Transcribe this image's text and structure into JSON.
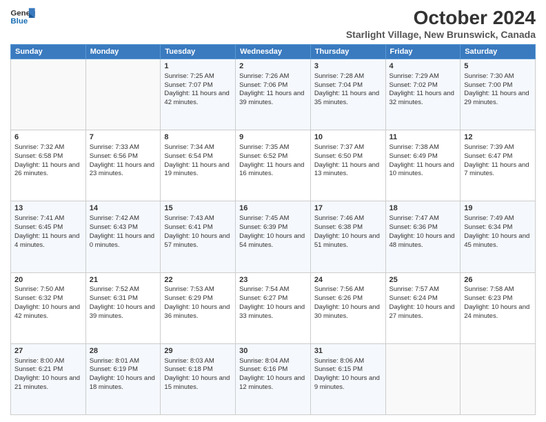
{
  "logo": {
    "line1": "General",
    "line2": "Blue"
  },
  "title": "October 2024",
  "subtitle": "Starlight Village, New Brunswick, Canada",
  "days_of_week": [
    "Sunday",
    "Monday",
    "Tuesday",
    "Wednesday",
    "Thursday",
    "Friday",
    "Saturday"
  ],
  "weeks": [
    [
      {
        "day": "",
        "content": ""
      },
      {
        "day": "",
        "content": ""
      },
      {
        "day": "1",
        "content": "Sunrise: 7:25 AM\nSunset: 7:07 PM\nDaylight: 11 hours and 42 minutes."
      },
      {
        "day": "2",
        "content": "Sunrise: 7:26 AM\nSunset: 7:06 PM\nDaylight: 11 hours and 39 minutes."
      },
      {
        "day": "3",
        "content": "Sunrise: 7:28 AM\nSunset: 7:04 PM\nDaylight: 11 hours and 35 minutes."
      },
      {
        "day": "4",
        "content": "Sunrise: 7:29 AM\nSunset: 7:02 PM\nDaylight: 11 hours and 32 minutes."
      },
      {
        "day": "5",
        "content": "Sunrise: 7:30 AM\nSunset: 7:00 PM\nDaylight: 11 hours and 29 minutes."
      }
    ],
    [
      {
        "day": "6",
        "content": "Sunrise: 7:32 AM\nSunset: 6:58 PM\nDaylight: 11 hours and 26 minutes."
      },
      {
        "day": "7",
        "content": "Sunrise: 7:33 AM\nSunset: 6:56 PM\nDaylight: 11 hours and 23 minutes."
      },
      {
        "day": "8",
        "content": "Sunrise: 7:34 AM\nSunset: 6:54 PM\nDaylight: 11 hours and 19 minutes."
      },
      {
        "day": "9",
        "content": "Sunrise: 7:35 AM\nSunset: 6:52 PM\nDaylight: 11 hours and 16 minutes."
      },
      {
        "day": "10",
        "content": "Sunrise: 7:37 AM\nSunset: 6:50 PM\nDaylight: 11 hours and 13 minutes."
      },
      {
        "day": "11",
        "content": "Sunrise: 7:38 AM\nSunset: 6:49 PM\nDaylight: 11 hours and 10 minutes."
      },
      {
        "day": "12",
        "content": "Sunrise: 7:39 AM\nSunset: 6:47 PM\nDaylight: 11 hours and 7 minutes."
      }
    ],
    [
      {
        "day": "13",
        "content": "Sunrise: 7:41 AM\nSunset: 6:45 PM\nDaylight: 11 hours and 4 minutes."
      },
      {
        "day": "14",
        "content": "Sunrise: 7:42 AM\nSunset: 6:43 PM\nDaylight: 11 hours and 0 minutes."
      },
      {
        "day": "15",
        "content": "Sunrise: 7:43 AM\nSunset: 6:41 PM\nDaylight: 10 hours and 57 minutes."
      },
      {
        "day": "16",
        "content": "Sunrise: 7:45 AM\nSunset: 6:39 PM\nDaylight: 10 hours and 54 minutes."
      },
      {
        "day": "17",
        "content": "Sunrise: 7:46 AM\nSunset: 6:38 PM\nDaylight: 10 hours and 51 minutes."
      },
      {
        "day": "18",
        "content": "Sunrise: 7:47 AM\nSunset: 6:36 PM\nDaylight: 10 hours and 48 minutes."
      },
      {
        "day": "19",
        "content": "Sunrise: 7:49 AM\nSunset: 6:34 PM\nDaylight: 10 hours and 45 minutes."
      }
    ],
    [
      {
        "day": "20",
        "content": "Sunrise: 7:50 AM\nSunset: 6:32 PM\nDaylight: 10 hours and 42 minutes."
      },
      {
        "day": "21",
        "content": "Sunrise: 7:52 AM\nSunset: 6:31 PM\nDaylight: 10 hours and 39 minutes."
      },
      {
        "day": "22",
        "content": "Sunrise: 7:53 AM\nSunset: 6:29 PM\nDaylight: 10 hours and 36 minutes."
      },
      {
        "day": "23",
        "content": "Sunrise: 7:54 AM\nSunset: 6:27 PM\nDaylight: 10 hours and 33 minutes."
      },
      {
        "day": "24",
        "content": "Sunrise: 7:56 AM\nSunset: 6:26 PM\nDaylight: 10 hours and 30 minutes."
      },
      {
        "day": "25",
        "content": "Sunrise: 7:57 AM\nSunset: 6:24 PM\nDaylight: 10 hours and 27 minutes."
      },
      {
        "day": "26",
        "content": "Sunrise: 7:58 AM\nSunset: 6:23 PM\nDaylight: 10 hours and 24 minutes."
      }
    ],
    [
      {
        "day": "27",
        "content": "Sunrise: 8:00 AM\nSunset: 6:21 PM\nDaylight: 10 hours and 21 minutes."
      },
      {
        "day": "28",
        "content": "Sunrise: 8:01 AM\nSunset: 6:19 PM\nDaylight: 10 hours and 18 minutes."
      },
      {
        "day": "29",
        "content": "Sunrise: 8:03 AM\nSunset: 6:18 PM\nDaylight: 10 hours and 15 minutes."
      },
      {
        "day": "30",
        "content": "Sunrise: 8:04 AM\nSunset: 6:16 PM\nDaylight: 10 hours and 12 minutes."
      },
      {
        "day": "31",
        "content": "Sunrise: 8:06 AM\nSunset: 6:15 PM\nDaylight: 10 hours and 9 minutes."
      },
      {
        "day": "",
        "content": ""
      },
      {
        "day": "",
        "content": ""
      }
    ]
  ]
}
